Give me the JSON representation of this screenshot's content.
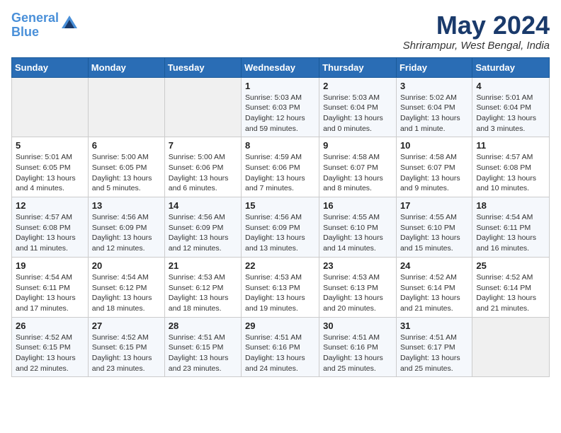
{
  "header": {
    "logo_line1": "General",
    "logo_line2": "Blue",
    "month": "May 2024",
    "location": "Shrirampur, West Bengal, India"
  },
  "weekdays": [
    "Sunday",
    "Monday",
    "Tuesday",
    "Wednesday",
    "Thursday",
    "Friday",
    "Saturday"
  ],
  "weeks": [
    [
      {
        "day": "",
        "info": ""
      },
      {
        "day": "",
        "info": ""
      },
      {
        "day": "",
        "info": ""
      },
      {
        "day": "1",
        "info": "Sunrise: 5:03 AM\nSunset: 6:03 PM\nDaylight: 12 hours\nand 59 minutes."
      },
      {
        "day": "2",
        "info": "Sunrise: 5:03 AM\nSunset: 6:04 PM\nDaylight: 13 hours\nand 0 minutes."
      },
      {
        "day": "3",
        "info": "Sunrise: 5:02 AM\nSunset: 6:04 PM\nDaylight: 13 hours\nand 1 minute."
      },
      {
        "day": "4",
        "info": "Sunrise: 5:01 AM\nSunset: 6:04 PM\nDaylight: 13 hours\nand 3 minutes."
      }
    ],
    [
      {
        "day": "5",
        "info": "Sunrise: 5:01 AM\nSunset: 6:05 PM\nDaylight: 13 hours\nand 4 minutes."
      },
      {
        "day": "6",
        "info": "Sunrise: 5:00 AM\nSunset: 6:05 PM\nDaylight: 13 hours\nand 5 minutes."
      },
      {
        "day": "7",
        "info": "Sunrise: 5:00 AM\nSunset: 6:06 PM\nDaylight: 13 hours\nand 6 minutes."
      },
      {
        "day": "8",
        "info": "Sunrise: 4:59 AM\nSunset: 6:06 PM\nDaylight: 13 hours\nand 7 minutes."
      },
      {
        "day": "9",
        "info": "Sunrise: 4:58 AM\nSunset: 6:07 PM\nDaylight: 13 hours\nand 8 minutes."
      },
      {
        "day": "10",
        "info": "Sunrise: 4:58 AM\nSunset: 6:07 PM\nDaylight: 13 hours\nand 9 minutes."
      },
      {
        "day": "11",
        "info": "Sunrise: 4:57 AM\nSunset: 6:08 PM\nDaylight: 13 hours\nand 10 minutes."
      }
    ],
    [
      {
        "day": "12",
        "info": "Sunrise: 4:57 AM\nSunset: 6:08 PM\nDaylight: 13 hours\nand 11 minutes."
      },
      {
        "day": "13",
        "info": "Sunrise: 4:56 AM\nSunset: 6:09 PM\nDaylight: 13 hours\nand 12 minutes."
      },
      {
        "day": "14",
        "info": "Sunrise: 4:56 AM\nSunset: 6:09 PM\nDaylight: 13 hours\nand 12 minutes."
      },
      {
        "day": "15",
        "info": "Sunrise: 4:56 AM\nSunset: 6:09 PM\nDaylight: 13 hours\nand 13 minutes."
      },
      {
        "day": "16",
        "info": "Sunrise: 4:55 AM\nSunset: 6:10 PM\nDaylight: 13 hours\nand 14 minutes."
      },
      {
        "day": "17",
        "info": "Sunrise: 4:55 AM\nSunset: 6:10 PM\nDaylight: 13 hours\nand 15 minutes."
      },
      {
        "day": "18",
        "info": "Sunrise: 4:54 AM\nSunset: 6:11 PM\nDaylight: 13 hours\nand 16 minutes."
      }
    ],
    [
      {
        "day": "19",
        "info": "Sunrise: 4:54 AM\nSunset: 6:11 PM\nDaylight: 13 hours\nand 17 minutes."
      },
      {
        "day": "20",
        "info": "Sunrise: 4:54 AM\nSunset: 6:12 PM\nDaylight: 13 hours\nand 18 minutes."
      },
      {
        "day": "21",
        "info": "Sunrise: 4:53 AM\nSunset: 6:12 PM\nDaylight: 13 hours\nand 18 minutes."
      },
      {
        "day": "22",
        "info": "Sunrise: 4:53 AM\nSunset: 6:13 PM\nDaylight: 13 hours\nand 19 minutes."
      },
      {
        "day": "23",
        "info": "Sunrise: 4:53 AM\nSunset: 6:13 PM\nDaylight: 13 hours\nand 20 minutes."
      },
      {
        "day": "24",
        "info": "Sunrise: 4:52 AM\nSunset: 6:14 PM\nDaylight: 13 hours\nand 21 minutes."
      },
      {
        "day": "25",
        "info": "Sunrise: 4:52 AM\nSunset: 6:14 PM\nDaylight: 13 hours\nand 21 minutes."
      }
    ],
    [
      {
        "day": "26",
        "info": "Sunrise: 4:52 AM\nSunset: 6:15 PM\nDaylight: 13 hours\nand 22 minutes."
      },
      {
        "day": "27",
        "info": "Sunrise: 4:52 AM\nSunset: 6:15 PM\nDaylight: 13 hours\nand 23 minutes."
      },
      {
        "day": "28",
        "info": "Sunrise: 4:51 AM\nSunset: 6:15 PM\nDaylight: 13 hours\nand 23 minutes."
      },
      {
        "day": "29",
        "info": "Sunrise: 4:51 AM\nSunset: 6:16 PM\nDaylight: 13 hours\nand 24 minutes."
      },
      {
        "day": "30",
        "info": "Sunrise: 4:51 AM\nSunset: 6:16 PM\nDaylight: 13 hours\nand 25 minutes."
      },
      {
        "day": "31",
        "info": "Sunrise: 4:51 AM\nSunset: 6:17 PM\nDaylight: 13 hours\nand 25 minutes."
      },
      {
        "day": "",
        "info": ""
      }
    ]
  ]
}
